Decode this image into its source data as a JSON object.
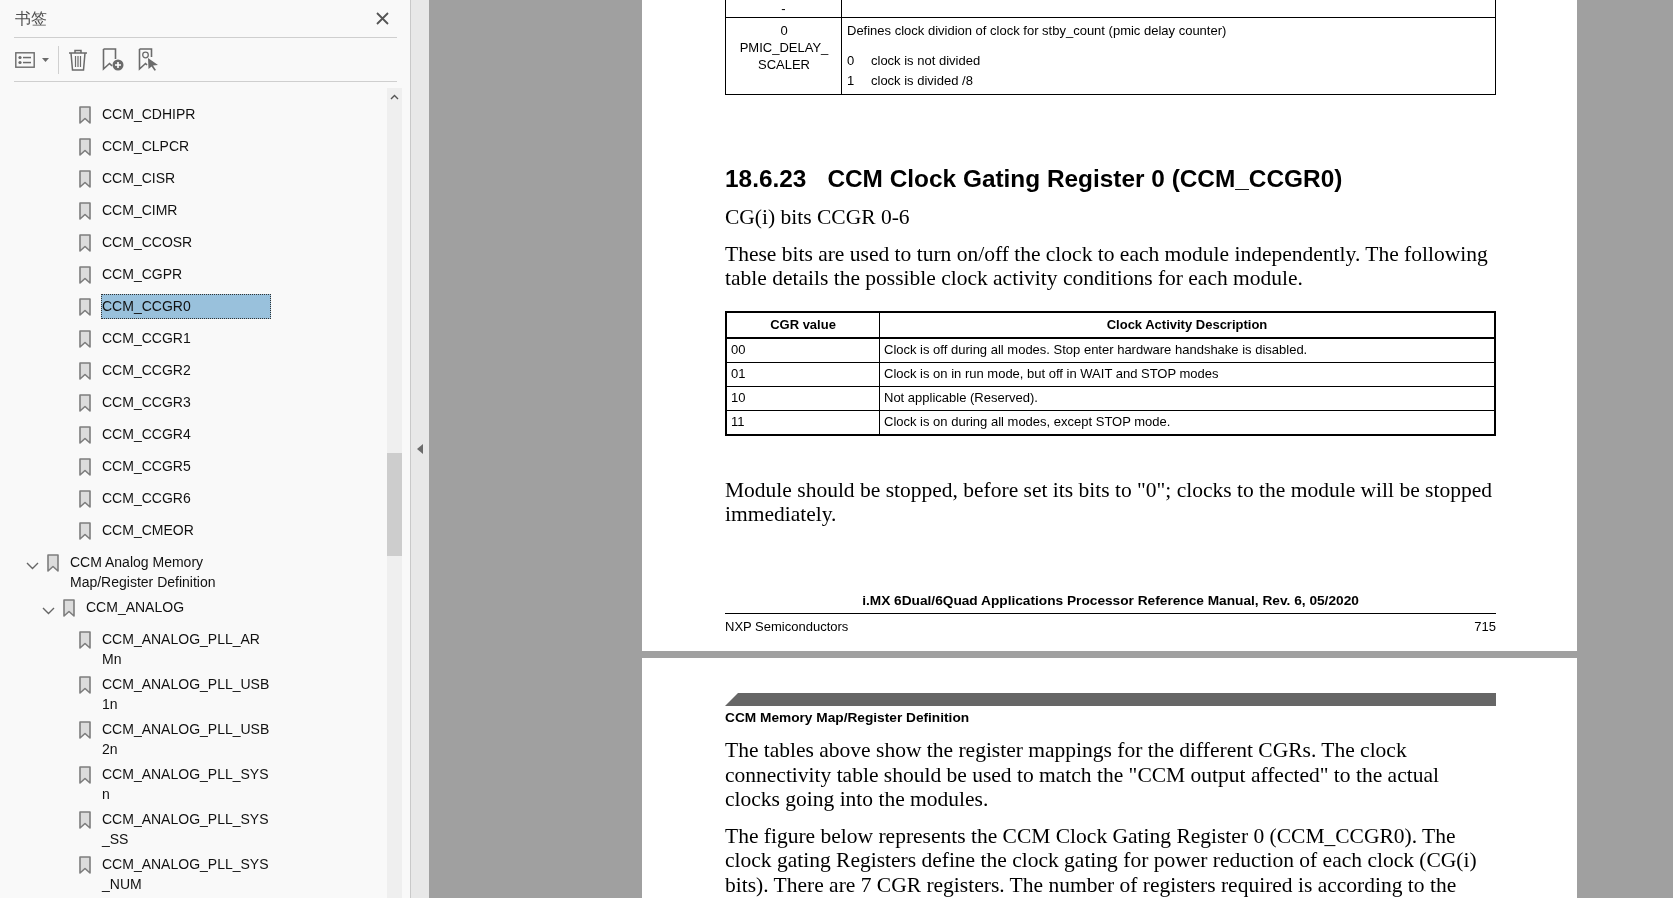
{
  "bookmarks_panel": {
    "title": "书签",
    "tree": [
      {
        "children": [
          {
            "children": [
              {
                "label": "CCM_CDHIPR",
                "selected": false
              },
              {
                "label": "CCM_CLPCR",
                "selected": false
              },
              {
                "label": "CCM_CISR",
                "selected": false
              },
              {
                "label": "CCM_CIMR",
                "selected": false
              },
              {
                "label": "CCM_CCOSR",
                "selected": false
              },
              {
                "label": "CCM_CGPR",
                "selected": false
              },
              {
                "label": "CCM_CCGR0",
                "selected": true
              },
              {
                "label": "CCM_CCGR1",
                "selected": false
              },
              {
                "label": "CCM_CCGR2",
                "selected": false
              },
              {
                "label": "CCM_CCGR3",
                "selected": false
              },
              {
                "label": "CCM_CCGR4",
                "selected": false
              },
              {
                "label": "CCM_CCGR5",
                "selected": false
              },
              {
                "label": "CCM_CCGR6",
                "selected": false
              },
              {
                "label": "CCM_CMEOR",
                "selected": false
              }
            ]
          }
        ]
      },
      {
        "label": "CCM Analog Memory Map/Register Definition",
        "expanded": true,
        "selected": false,
        "children": [
          {
            "label": "CCM_ANALOG",
            "expanded": true,
            "selected": false,
            "children": [
              {
                "label": "CCM_ANALOG_PLL_ARMn",
                "selected": false
              },
              {
                "label": "CCM_ANALOG_PLL_USB1n",
                "selected": false
              },
              {
                "label": "CCM_ANALOG_PLL_USB2n",
                "selected": false
              },
              {
                "label": "CCM_ANALOG_PLL_SYSn",
                "selected": false
              },
              {
                "label": "CCM_ANALOG_PLL_SYS_SS",
                "selected": false
              },
              {
                "label": "CCM_ANALOG_PLL_SYS_NUM",
                "selected": false
              }
            ]
          }
        ]
      }
    ]
  },
  "document": {
    "pages": [
      {
        "blocks": [
          {
            "kind": "register_table",
            "rows": [
              {
                "field": "-"
              },
              {
                "bits": "0",
                "field": "PMIC_DELAY_SCALER",
                "description": "Defines clock dividion of clock for stby_count (pmic delay counter)",
                "options": [
                  {
                    "value": "0",
                    "meaning": "clock is not divided"
                  },
                  {
                    "value": "1",
                    "meaning": "clock is divided /8"
                  }
                ]
              }
            ]
          },
          {
            "kind": "heading",
            "number": "18.6.23",
            "title": "CCM Clock Gating Register 0 (CCM_CCGR0)"
          },
          {
            "kind": "paragraph",
            "text": "CG(i) bits CCGR 0-6"
          },
          {
            "kind": "paragraph",
            "text": "These bits are used to turn on/off the clock to each module independently. The following table details the possible clock activity conditions for each module."
          },
          {
            "kind": "table",
            "columns": [
              "CGR value",
              "Clock Activity Description"
            ],
            "rows": [
              [
                "00",
                "Clock is off during all modes. Stop enter hardware handshake is disabled."
              ],
              [
                "01",
                "Clock is on in run mode, but off in WAIT and STOP modes"
              ],
              [
                "10",
                "Not applicable (Reserved)."
              ],
              [
                "11",
                "Clock is on during all modes, except STOP mode."
              ]
            ]
          },
          {
            "kind": "paragraph",
            "text": "Module should be stopped, before set its bits to \"0\"; clocks to the module will be stopped immediately."
          }
        ],
        "footer": {
          "title": "i.MX 6Dual/6Quad Applications Processor Reference Manual, Rev. 6, 05/2020",
          "publisher": "NXP Semiconductors",
          "page_number": "715"
        }
      },
      {
        "header": "CCM Memory Map/Register Definition",
        "blocks": [
          {
            "kind": "paragraph",
            "text": "The tables above show the register mappings for the different CGRs. The clock connectivity table should be used to match the \"CCM output affected\" to the actual clocks going into the modules."
          },
          {
            "kind": "paragraph",
            "text": "The figure below represents the CCM Clock Gating Register 0 (CCM_CCGR0). The clock gating Registers define the clock gating for power reduction of each clock (CG(i) bits). There are 7 CGR registers. The number of registers required is according to the"
          }
        ]
      }
    ]
  }
}
